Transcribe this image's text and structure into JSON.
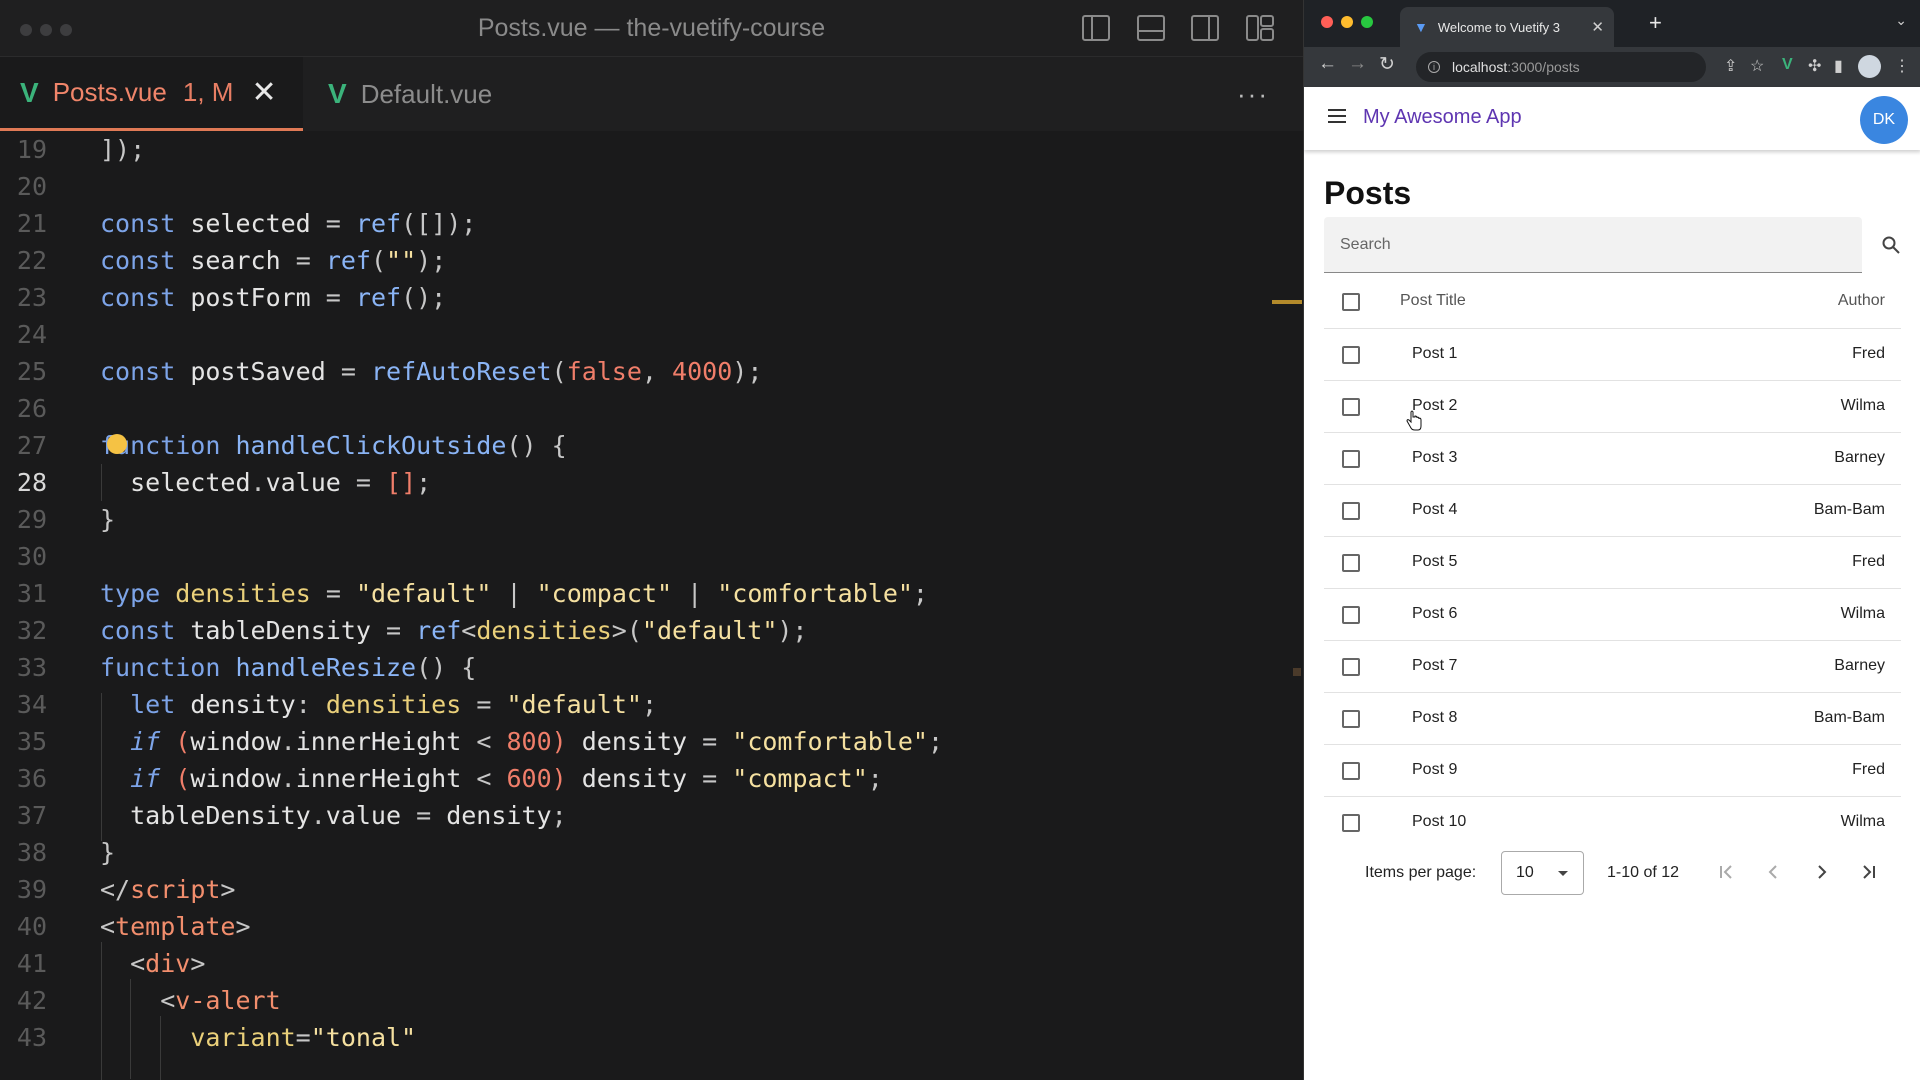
{
  "editor": {
    "title": "Posts.vue — the-vuetify-course",
    "tabs": [
      {
        "label": "Posts.vue",
        "badge": "1, M",
        "close": "✕"
      },
      {
        "label": "Default.vue"
      }
    ],
    "more": "···",
    "vue_glyph": "V",
    "line_numbers": [
      "19",
      "20",
      "21",
      "22",
      "23",
      "24",
      "25",
      "26",
      "27",
      "28",
      "29",
      "30",
      "31",
      "32",
      "33",
      "34",
      "35",
      "36",
      "37",
      "38",
      "39",
      "40",
      "41",
      "42",
      "43"
    ]
  },
  "browser": {
    "tab_title": "Welcome to Vuetify 3",
    "tab_close": "✕",
    "new_tab": "+",
    "url_host": "localhost",
    "url_path": ":3000/posts",
    "app_title": "My Awesome App",
    "avatar_initials": "DK",
    "page_title": "Posts",
    "search_placeholder": "Search",
    "table": {
      "headers": {
        "title": "Post Title",
        "author": "Author"
      },
      "rows": [
        {
          "title": "Post 1",
          "author": "Fred"
        },
        {
          "title": "Post 2",
          "author": "Wilma"
        },
        {
          "title": "Post 3",
          "author": "Barney"
        },
        {
          "title": "Post 4",
          "author": "Bam-Bam"
        },
        {
          "title": "Post 5",
          "author": "Fred"
        },
        {
          "title": "Post 6",
          "author": "Wilma"
        },
        {
          "title": "Post 7",
          "author": "Barney"
        },
        {
          "title": "Post 8",
          "author": "Bam-Bam"
        },
        {
          "title": "Post 9",
          "author": "Fred"
        },
        {
          "title": "Post 10",
          "author": "Wilma"
        }
      ]
    },
    "pagination": {
      "items_per_page_label": "Items per page:",
      "items_per_page": "10",
      "range": "1-10 of 12"
    }
  },
  "colors": {
    "editor_bg": "#1a1a1b",
    "tab_accent": "#e07a56",
    "vue_green": "#3bb37b",
    "app_title": "#5e35b1",
    "avatar": "#3a86e0"
  }
}
